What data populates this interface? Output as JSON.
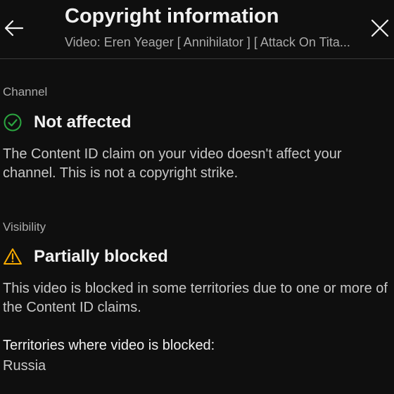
{
  "header": {
    "title": "Copyright information",
    "subtitle": "Video: Eren Yeager [ Annihilator ] [ Attack On Tita..."
  },
  "channel": {
    "label": "Channel",
    "status": "Not affected",
    "status_icon": "check-circle-icon",
    "status_color": "#2ba640",
    "description": "The Content ID claim on your video doesn't affect your channel. This is not a copyright strike."
  },
  "visibility": {
    "label": "Visibility",
    "status": "Partially blocked",
    "status_icon": "warning-icon",
    "status_color": "#f9ab00",
    "description": "This video is blocked in some territories due to one or more of the Content ID claims."
  },
  "territories": {
    "label": "Territories where video is blocked:",
    "value": "Russia"
  }
}
